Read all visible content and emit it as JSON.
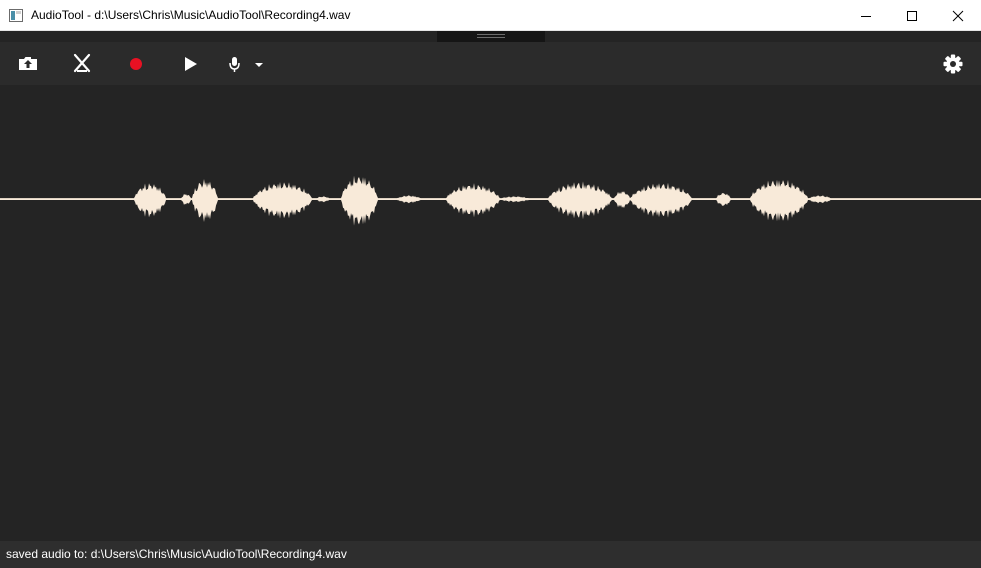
{
  "window": {
    "title": "AudioTool - d:\\Users\\Chris\\Music\\AudioTool\\Recording4.wav",
    "controls": [
      "minimize-icon",
      "maximize-icon",
      "close-icon"
    ]
  },
  "toolbar": {
    "buttons": [
      {
        "name": "open-file",
        "icon": "folder-upload-icon"
      },
      {
        "name": "cut",
        "icon": "scissors-icon"
      },
      {
        "name": "record",
        "icon": "record-icon",
        "color": "#e81123"
      },
      {
        "name": "play",
        "icon": "play-icon"
      },
      {
        "name": "microphone-select",
        "icon": "microphone-icon"
      },
      {
        "name": "settings",
        "icon": "gear-icon"
      }
    ]
  },
  "waveform": {
    "color": "#f8ead9",
    "background": "#242424"
  },
  "status": {
    "text": "saved audio to: d:\\Users\\Chris\\Music\\AudioTool\\Recording4.wav"
  }
}
